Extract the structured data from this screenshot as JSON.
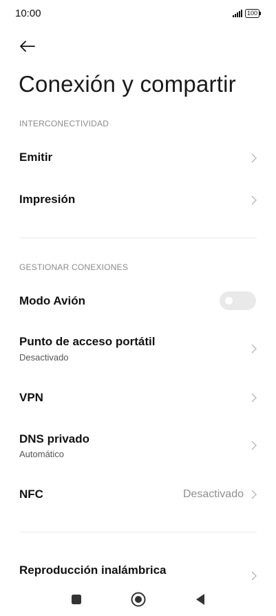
{
  "status_bar": {
    "time": "10:00",
    "battery": "100",
    "icons": [
      "signal-icon",
      "battery-icon"
    ]
  },
  "header": {
    "back_icon": "back-arrow-icon",
    "title": "Conexión y compartir"
  },
  "sections": [
    {
      "header": "INTERCONECTIVIDAD",
      "items": [
        {
          "label": "Emitir"
        },
        {
          "label": "Impresión"
        }
      ]
    },
    {
      "header": "GESTIONAR CONEXIONES",
      "items": [
        {
          "label": "Modo Avión",
          "toggle": false
        },
        {
          "label": "Punto de acceso portátil",
          "subtitle": "Desactivado"
        },
        {
          "label": "VPN"
        },
        {
          "label": "DNS privado",
          "subtitle": "Automático"
        },
        {
          "label": "NFC",
          "value": "Desactivado"
        }
      ]
    },
    {
      "items": [
        {
          "label": "Reproducción inalámbrica"
        }
      ]
    }
  ],
  "nav_bar": {
    "icons": [
      "recent-apps-icon",
      "home-icon",
      "back-icon"
    ]
  },
  "colors": {
    "background": "#ffffff",
    "text": "#111111",
    "secondary_text": "#8a8a8a",
    "toggle_off": "#e9e9e9"
  }
}
